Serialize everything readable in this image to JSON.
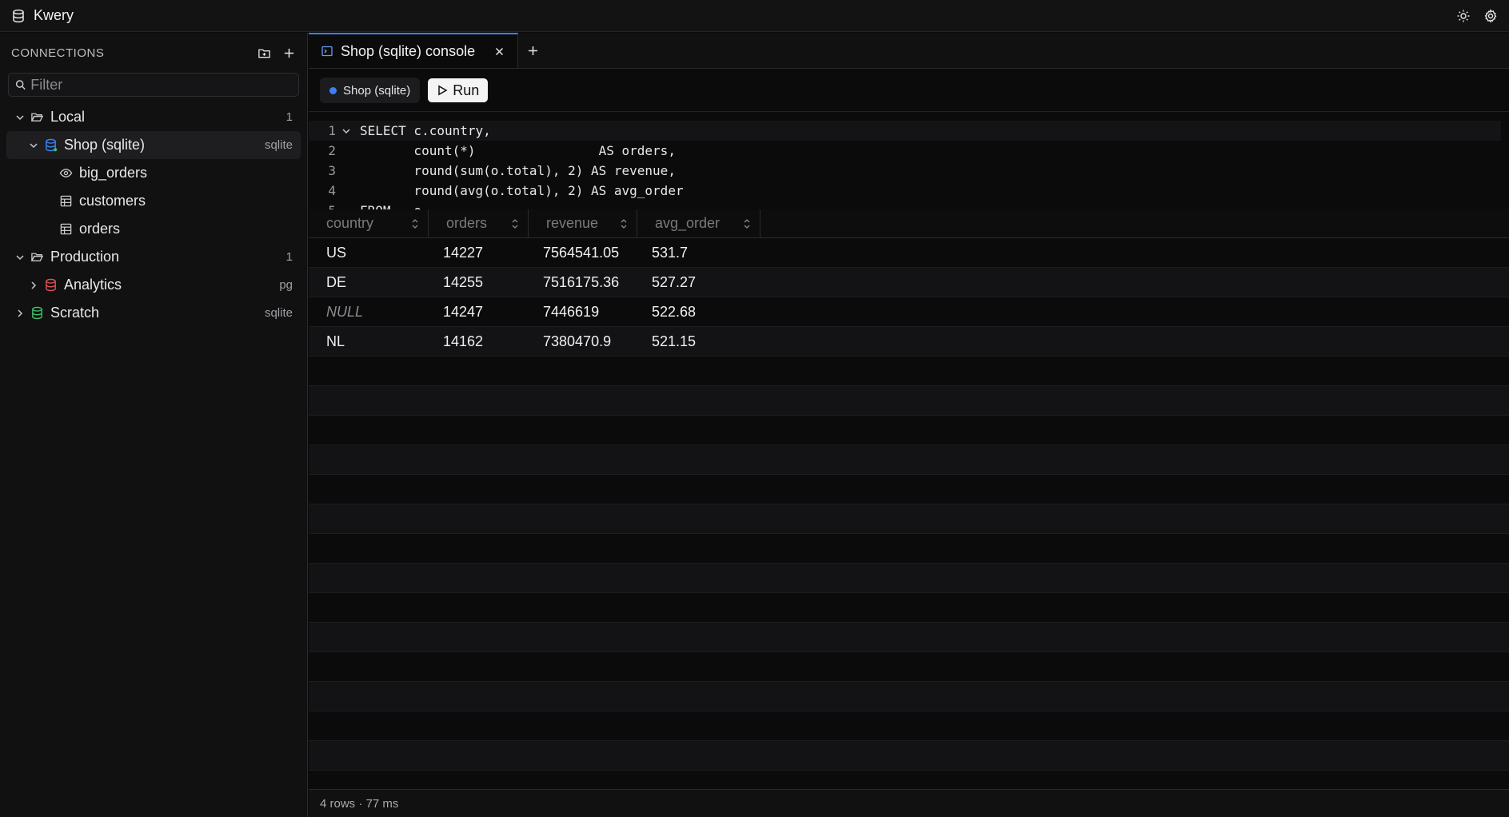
{
  "app": {
    "title": "Kwery",
    "icon": "database-icon"
  },
  "titlebar": {
    "theme_icon": "sun-icon",
    "settings_icon": "gear-icon"
  },
  "sidebar": {
    "header": "CONNECTIONS",
    "filter_placeholder": "Filter",
    "tree": [
      {
        "name": "Local",
        "meta": "1",
        "type": "folder",
        "expanded": true
      },
      {
        "name": "Shop (sqlite)",
        "meta": "sqlite",
        "type": "database",
        "expanded": true,
        "selected": true,
        "color": "#3b82f6"
      },
      {
        "name": "big_orders",
        "type": "view"
      },
      {
        "name": "customers",
        "type": "table"
      },
      {
        "name": "orders",
        "type": "table"
      },
      {
        "name": "Production",
        "meta": "1",
        "type": "folder",
        "expanded": true
      },
      {
        "name": "Analytics",
        "meta": "pg",
        "type": "database",
        "expanded": false,
        "color": "#e05252"
      },
      {
        "name": "Scratch",
        "meta": "sqlite",
        "type": "database",
        "expanded": false,
        "color": "#3fbf6a"
      }
    ]
  },
  "tabs": [
    {
      "label": "Shop (sqlite) console",
      "active": true
    }
  ],
  "toolbar": {
    "connection": "Shop (sqlite)",
    "run_label": "Run",
    "connection_color": "#3b82f6"
  },
  "editor": {
    "lines": [
      {
        "n": "1",
        "text": "SELECT c.country,"
      },
      {
        "n": "2",
        "text": "       count(*)                AS orders,"
      },
      {
        "n": "3",
        "text": "       round(sum(o.total), 2) AS revenue,"
      },
      {
        "n": "4",
        "text": "       round(avg(o.total), 2) AS avg_order"
      },
      {
        "n": "5",
        "text": "FROM   o"
      }
    ]
  },
  "results": {
    "columns": [
      "country",
      "orders",
      "revenue",
      "avg_order"
    ],
    "rows": [
      [
        "US",
        "14227",
        "7564541.05",
        "531.7"
      ],
      [
        "DE",
        "14255",
        "7516175.36",
        "527.27"
      ],
      [
        "NULL",
        "14247",
        "7446619",
        "522.68"
      ],
      [
        "NL",
        "14162",
        "7380470.9",
        "521.15"
      ]
    ]
  },
  "status": {
    "text": "4 rows · 77 ms"
  }
}
